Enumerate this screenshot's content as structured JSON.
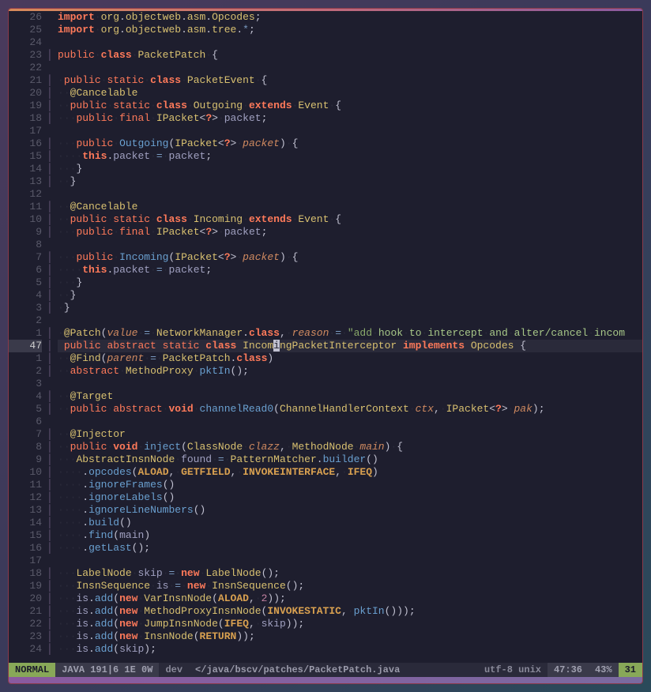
{
  "gutter": [
    "26",
    "25",
    "24",
    "23",
    "22",
    "21",
    "20",
    "19",
    "18",
    "17",
    "16",
    "15",
    "14",
    "13",
    "12",
    "11",
    "10",
    "9",
    "8",
    "7",
    "6",
    "5",
    "4",
    "3",
    "2",
    "1",
    "47",
    "1",
    "2",
    "3",
    "4",
    "5",
    "6",
    "7",
    "8",
    "9",
    "10",
    "11",
    "12",
    "13",
    "14",
    "15",
    "16",
    "17",
    "18",
    "19",
    "20",
    "21",
    "22",
    "23",
    "24"
  ],
  "current_line_index": 26,
  "fold_marks": [
    "",
    "",
    "",
    "│",
    "",
    "│",
    "│",
    "│",
    "│",
    "",
    "│",
    "│",
    "│",
    "│",
    "",
    "│",
    "│",
    "│",
    "",
    "│",
    "│",
    "│",
    "│",
    "│",
    "",
    "│",
    "│",
    "│",
    "│",
    "",
    "│",
    "│",
    "",
    "│",
    "│",
    "│",
    "│",
    "│",
    "│",
    "│",
    "│",
    "│",
    "│",
    "",
    "│",
    "│",
    "│",
    "│",
    "│",
    "│",
    "│"
  ],
  "statusbar": {
    "mode": "NORMAL",
    "info": "JAVA 191|6 1E 0W",
    "git": "dev",
    "file": "</java/bscv/patches/PacketPatch.java",
    "enc": "utf-8 unix",
    "pos": "47:36",
    "pct": "43%",
    "col": "31"
  },
  "code": {
    "l0": {
      "a": "import",
      "b": "org",
      "c": "objectweb",
      "d": "asm",
      "e": "Opcodes"
    },
    "l1": {
      "a": "import",
      "b": "org",
      "c": "objectweb",
      "d": "asm",
      "e": "tree"
    },
    "l3": {
      "a": "public",
      "b": "class",
      "c": "PacketPatch"
    },
    "l5": {
      "a": "public",
      "b": "static",
      "c": "class",
      "d": "PacketEvent"
    },
    "l6": {
      "a": "@",
      "b": "Cancelable"
    },
    "l7": {
      "a": "public",
      "b": "static",
      "c": "class",
      "d": "Outgoing",
      "e": "extends",
      "f": "Event"
    },
    "l8": {
      "a": "public",
      "b": "final",
      "c": "IPacket",
      "d": "packet"
    },
    "l10": {
      "a": "public",
      "b": "Outgoing",
      "c": "IPacket",
      "d": "packet"
    },
    "l11": {
      "a": "this",
      "b": "packet",
      "c": "packet"
    },
    "l15": {
      "a": "@",
      "b": "Cancelable"
    },
    "l16": {
      "a": "public",
      "b": "static",
      "c": "class",
      "d": "Incoming",
      "e": "extends",
      "f": "Event"
    },
    "l17": {
      "a": "public",
      "b": "final",
      "c": "IPacket",
      "d": "packet"
    },
    "l19": {
      "a": "public",
      "b": "Incoming",
      "c": "IPacket",
      "d": "packet"
    },
    "l20": {
      "a": "this",
      "b": "packet",
      "c": "packet"
    },
    "l25": {
      "a": "@",
      "b": "Patch",
      "c": "value",
      "d": "NetworkManager",
      "e": "class",
      "f": "reason",
      "g": "\"add",
      "h": "hook",
      "i": "to",
      "j": "intercept",
      "k": "and",
      "l": "alter/cancel",
      "m": "incom"
    },
    "l26": {
      "a": "public",
      "b": "abstract",
      "c": "static",
      "d": "class",
      "e": "Incom",
      "f": "ngPacketInterceptor",
      "g": "implements",
      "h": "Opcodes",
      "cur": "i"
    },
    "l27": {
      "a": "@",
      "b": "Find",
      "c": "parent",
      "d": "PacketPatch",
      "e": "class"
    },
    "l28": {
      "a": "abstract",
      "b": "MethodProxy",
      "c": "pktIn"
    },
    "l30": {
      "a": "@",
      "b": "Target"
    },
    "l31": {
      "a": "public",
      "b": "abstract",
      "c": "void",
      "d": "channelRead0",
      "e": "ChannelHandlerContext",
      "f": "ctx",
      "g": "IPacket",
      "h": "pak"
    },
    "l33": {
      "a": "@",
      "b": "Injector"
    },
    "l34": {
      "a": "public",
      "b": "void",
      "c": "inject",
      "d": "ClassNode",
      "e": "clazz",
      "f": "MethodNode",
      "g": "main"
    },
    "l35": {
      "a": "AbstractInsnNode",
      "b": "found",
      "c": "PatternMatcher",
      "d": "builder"
    },
    "l36": {
      "a": "opcodes",
      "b": "ALOAD",
      "c": "GETFIELD",
      "d": "INVOKEINTERFACE",
      "e": "IFEQ"
    },
    "l37": {
      "a": "ignoreFrames"
    },
    "l38": {
      "a": "ignoreLabels"
    },
    "l39": {
      "a": "ignoreLineNumbers"
    },
    "l40": {
      "a": "build"
    },
    "l41": {
      "a": "find",
      "b": "main"
    },
    "l42": {
      "a": "getLast"
    },
    "l44": {
      "a": "LabelNode",
      "b": "skip",
      "c": "new",
      "d": "LabelNode"
    },
    "l45": {
      "a": "InsnSequence",
      "b": "is",
      "c": "new",
      "d": "InsnSequence"
    },
    "l46": {
      "a": "is",
      "b": "add",
      "c": "new",
      "d": "VarInsnNode",
      "e": "ALOAD",
      "f": "2"
    },
    "l47": {
      "a": "is",
      "b": "add",
      "c": "new",
      "d": "MethodProxyInsnNode",
      "e": "INVOKESTATIC",
      "f": "pktIn"
    },
    "l48": {
      "a": "is",
      "b": "add",
      "c": "new",
      "d": "JumpInsnNode",
      "e": "IFEQ",
      "f": "skip"
    },
    "l49": {
      "a": "is",
      "b": "add",
      "c": "new",
      "d": "InsnNode",
      "e": "RETURN"
    },
    "l50": {
      "a": "is",
      "b": "add",
      "c": "skip"
    }
  }
}
